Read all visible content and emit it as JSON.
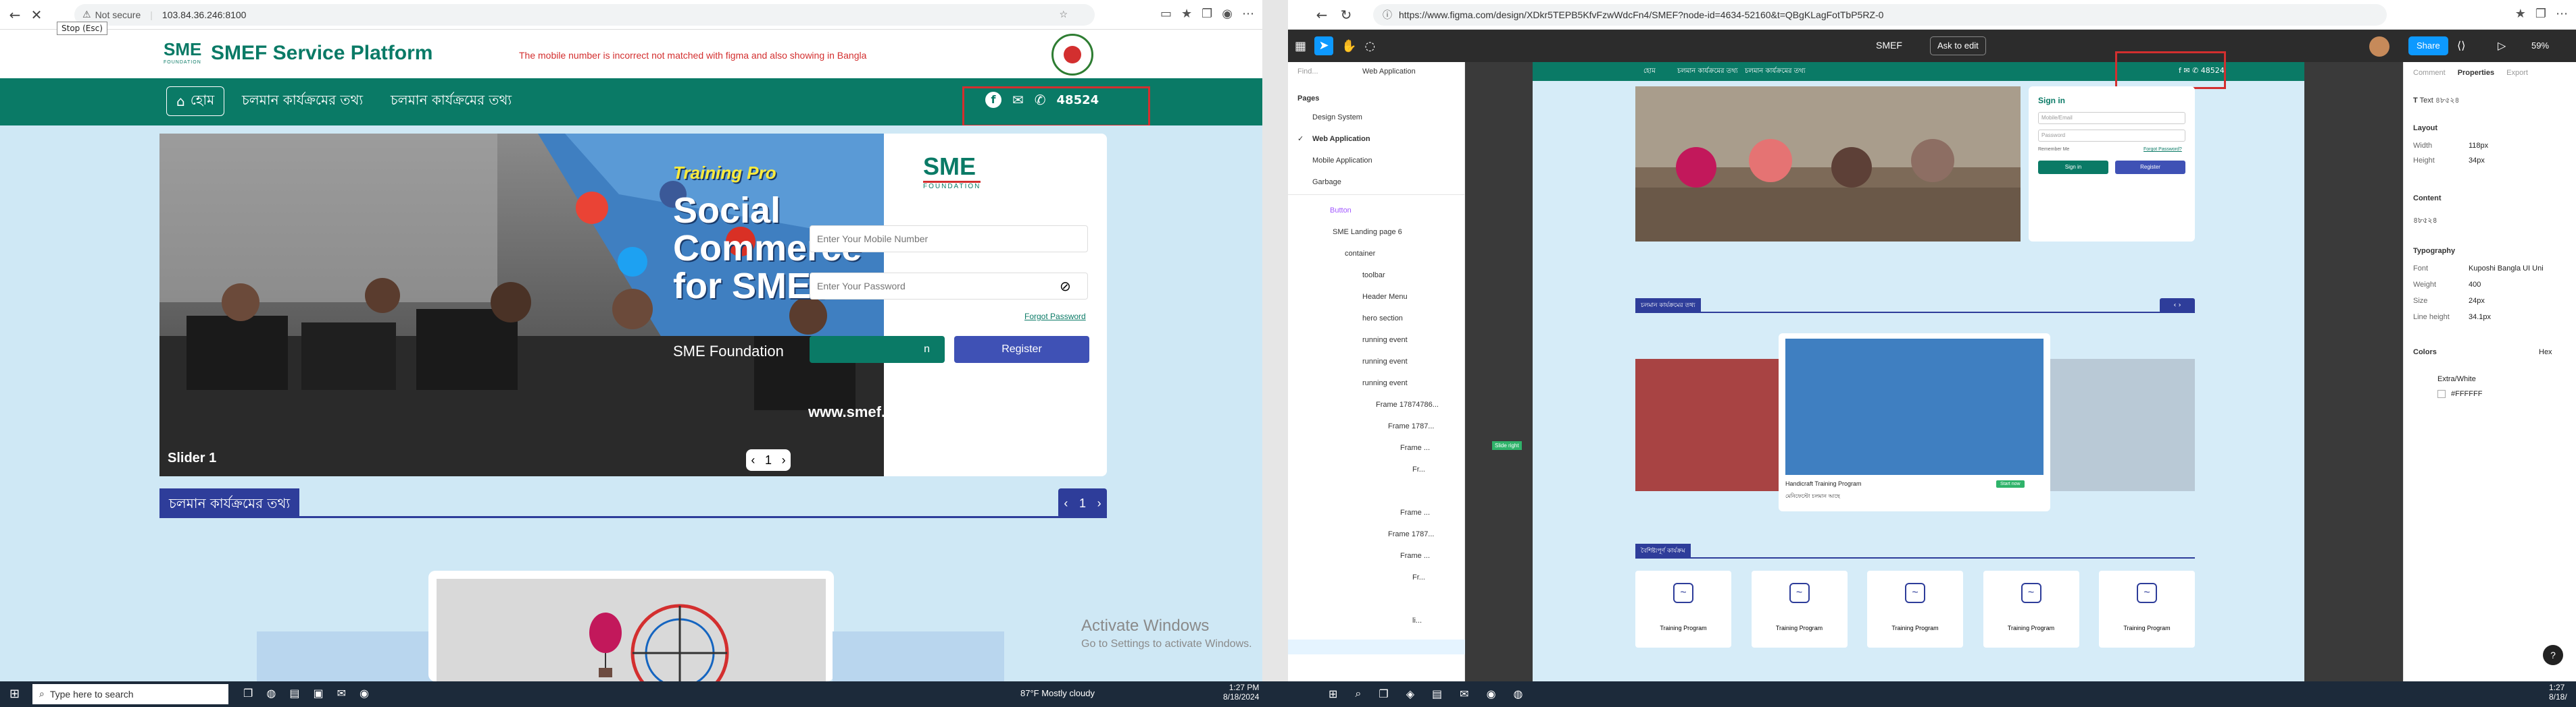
{
  "left_browser": {
    "security_label": "Not secure",
    "url": "103.84.36.246:8100",
    "tooltip": "Stop (Esc)",
    "site": {
      "brand_short": "SME",
      "brand_sub": "FOUNDATION",
      "title": "SMEF Service Platform",
      "annotation": "The mobile number is incorrect not matched with figma and also showing in Bangla",
      "nav": {
        "home": "হোম",
        "running_1": "চলমান কার্যক্রমের তথ্য",
        "running_2": "চলমান কার্যক্রমের তথ্য",
        "phone": "48524"
      },
      "slider": {
        "label": "Slider 1",
        "page": "1",
        "banner_line1": "Training Pro",
        "banner_line2": "Social",
        "banner_line3": "Commerce",
        "banner_line4": "for SMEs",
        "banner_org": "SME Foundation",
        "banner_url": "www.smef.g"
      },
      "login": {
        "brand_short": "SME",
        "brand_sub": "FOUNDATION",
        "mobile_placeholder": "Enter Your Mobile Number",
        "password_placeholder": "Enter Your Password",
        "forgot": "Forgot Password",
        "signin": "n",
        "register": "Register"
      },
      "section_title": "চলমান কার্যক্রমের তথ্য",
      "section_page": "1",
      "activate_title": "Activate Windows",
      "activate_sub": "Go to Settings to activate Windows."
    }
  },
  "right_browser": {
    "url": "https://www.figma.com/design/XDkr5TEPB5KfvFzwWdcFn4/SMEF?node-id=4634-52160&t=QBgKLagFotTbP5RZ-0",
    "toolbar": {
      "file_name": "SMEF",
      "ask_to_edit": "Ask to edit",
      "share": "Share",
      "zoom": "59%"
    },
    "layers_panel": {
      "search_placeholder": "Find...",
      "page_selector": "Web Application",
      "pages_heading": "Pages",
      "pages": [
        "Design System",
        "Web Application",
        "Mobile Application",
        "Garbage"
      ],
      "layers": [
        "Button",
        "SME Landing page 6",
        "container",
        "toolbar",
        "Header Menu",
        "hero section",
        "running event",
        "running event",
        "running event",
        "Frame 17874786...",
        "Frame 1787...",
        "Frame ...",
        "Fr...",
        "Frame ...",
        "Frame 1787...",
        "Frame ...",
        "Fr...",
        "li..."
      ]
    },
    "canvas": {
      "nav_home": "হোম",
      "nav_link_1": "চলমান কার্যক্রমের তথ্য",
      "nav_link_2": "চলমান কার্যক্রমের তথ্য",
      "phone": "48524",
      "signin_title": "Sign in",
      "mobile_placeholder": "Mobile/Email",
      "password_placeholder": "Password",
      "remember_me": "Remember Me",
      "forgot": "Forgot Password?",
      "signin_btn": "Sign in",
      "register_btn": "Register",
      "section_1": "চলমান কার্যক্রমের তথ্য",
      "card_title": "Handicraft Training Program",
      "card_sub": "মেনিফেস্টো চলমান আছে",
      "card_badge": "Start now",
      "section_2": "বৈশিষ্ট্যপূর্ণ কার্যক্রম",
      "program_label": "Training Program",
      "side_tag": "Slide right"
    },
    "props_panel": {
      "tabs": [
        "Comment",
        "Properties",
        "Export"
      ],
      "layer_type": "Text",
      "layer_name": "৪৮৫২৪",
      "layout_heading": "Layout",
      "width_label": "Width",
      "width_val": "118px",
      "height_label": "Height",
      "height_val": "34px",
      "content_heading": "Content",
      "content_val": "৪৮৫২৪",
      "typography_heading": "Typography",
      "font_label": "Font",
      "font_val": "Kuposhi Bangla UI Uni",
      "weight_label": "Weight",
      "weight_val": "400",
      "size_label": "Size",
      "size_val": "24px",
      "line_label": "Line height",
      "line_val": "34.1px",
      "colors_heading": "Colors",
      "colors_mode": "Hex",
      "color_name": "Extra/White",
      "color_hex": "#FFFFFF"
    }
  },
  "taskbar_left": {
    "search_placeholder": "Type here to search",
    "weather": "87°F  Mostly cloudy",
    "time": "1:27 PM",
    "date": "8/18/2024"
  },
  "taskbar_right": {
    "time": "1:27",
    "date": "8/18/"
  },
  "colors": {
    "brand_green": "#0a7a66",
    "page_bg": "#cfe8f5",
    "register_blue": "#3f51b5",
    "annotation_red": "#d32f2f",
    "section_blue": "#2e3d9a"
  }
}
